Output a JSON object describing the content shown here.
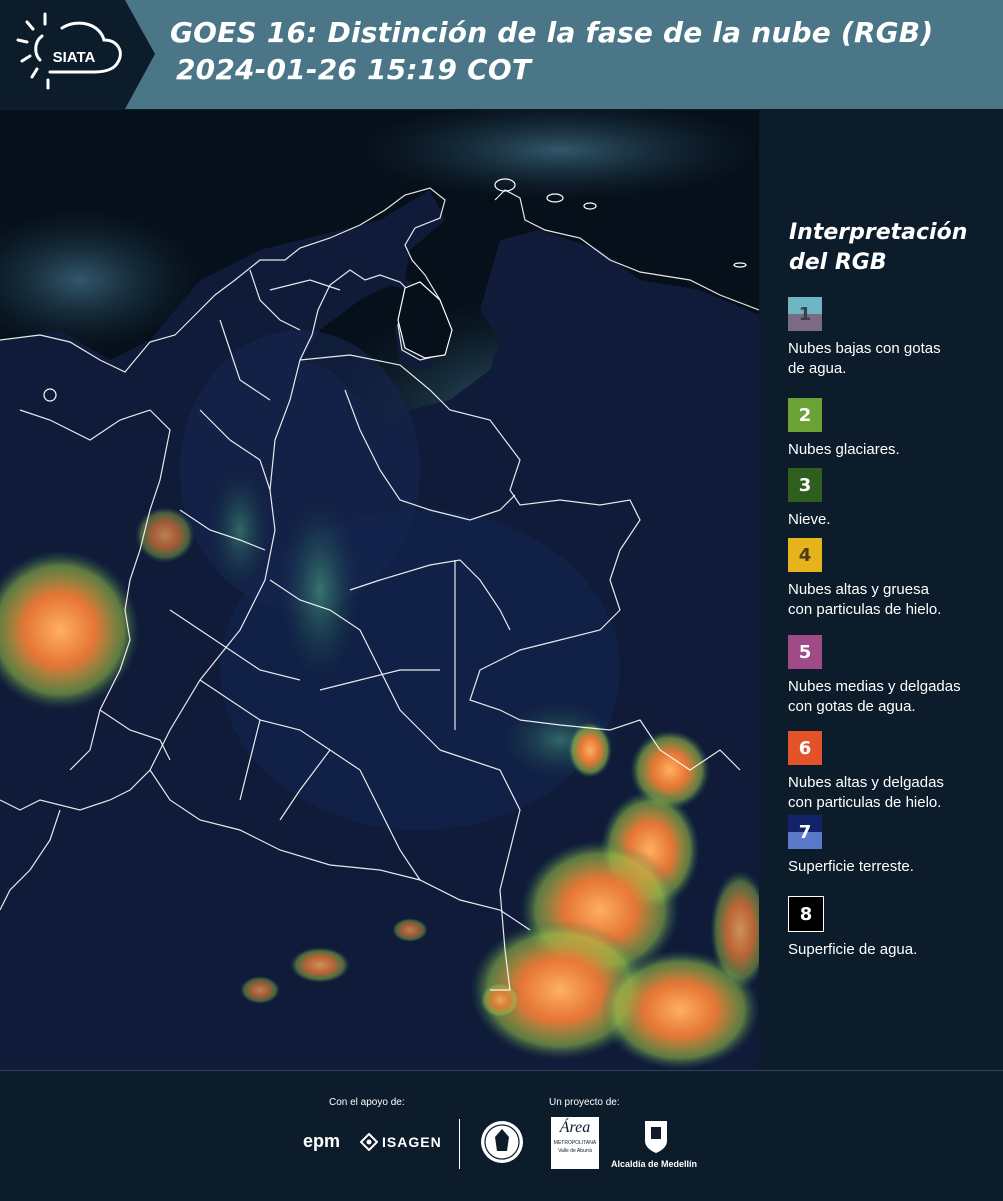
{
  "header": {
    "logo_text": "SIATA",
    "title_line1": "GOES 16: Distinción de la fase de la nube (RGB)",
    "title_line2": "2024-01-26 15:19 COT"
  },
  "legend": {
    "title_line1": "Interpretación",
    "title_line2": "del RGB",
    "items": [
      {
        "number": "1",
        "label_line1": "Nubes bajas con gotas",
        "label_line2": "de agua.",
        "color_top": "#6fb6c4",
        "color_bottom": "#7a6a86",
        "number_color": "#3a3f4a"
      },
      {
        "number": "2",
        "label_line1": "Nubes glaciares.",
        "label_line2": "",
        "color_top": "#6aa235",
        "color_bottom": "#6aa235",
        "number_color": "#ffffff"
      },
      {
        "number": "3",
        "label_line1": "Nieve.",
        "label_line2": "",
        "color_top": "#2f5f1f",
        "color_bottom": "#2f5f1f",
        "number_color": "#ffffff"
      },
      {
        "number": "4",
        "label_line1": "Nubes altas y gruesa",
        "label_line2": "con particulas de hielo.",
        "color_top": "#e6b31c",
        "color_bottom": "#e6b31c",
        "number_color": "#4a3a1a"
      },
      {
        "number": "5",
        "label_line1": "Nubes medias y delgadas",
        "label_line2": "con gotas de agua.",
        "color_top": "#a04a86",
        "color_bottom": "#a04a86",
        "number_color": "#ffffff"
      },
      {
        "number": "6",
        "label_line1": "Nubes altas y delgadas",
        "label_line2": "con particulas de hielo.",
        "color_top": "#e4522a",
        "color_bottom": "#e4522a",
        "number_color": "#ffffff"
      },
      {
        "number": "7",
        "label_line1": "Superficie terreste.",
        "label_line2": "",
        "color_top": "#13236b",
        "color_bottom": "#5a79c9",
        "number_color": "#ffffff"
      },
      {
        "number": "8",
        "label_line1": "Superficie de agua.",
        "label_line2": "",
        "color_top": "#000000",
        "color_bottom": "#000000",
        "number_color": "#ffffff"
      }
    ]
  },
  "footer": {
    "support_label": "Con el apoyo de:",
    "project_label": "Un proyecto de:",
    "sponsor1": "epm",
    "sponsor2": "ISAGEN",
    "partner_area_line1": "METROPOLITANA",
    "partner_area_line2": "Valle de Aburrá",
    "partner_area_script": "Área",
    "partner_medellin": "Alcaldía de Medellín"
  },
  "colors": {
    "header_bg": "#4a7687",
    "logo_bg": "#0c1c2b",
    "panel_bg": "#0c1c2b",
    "map_ocean": "#07121b",
    "map_land": "#101d3a",
    "cloud_orange": "#f08a3a",
    "cloud_green": "#6fcf6a"
  }
}
